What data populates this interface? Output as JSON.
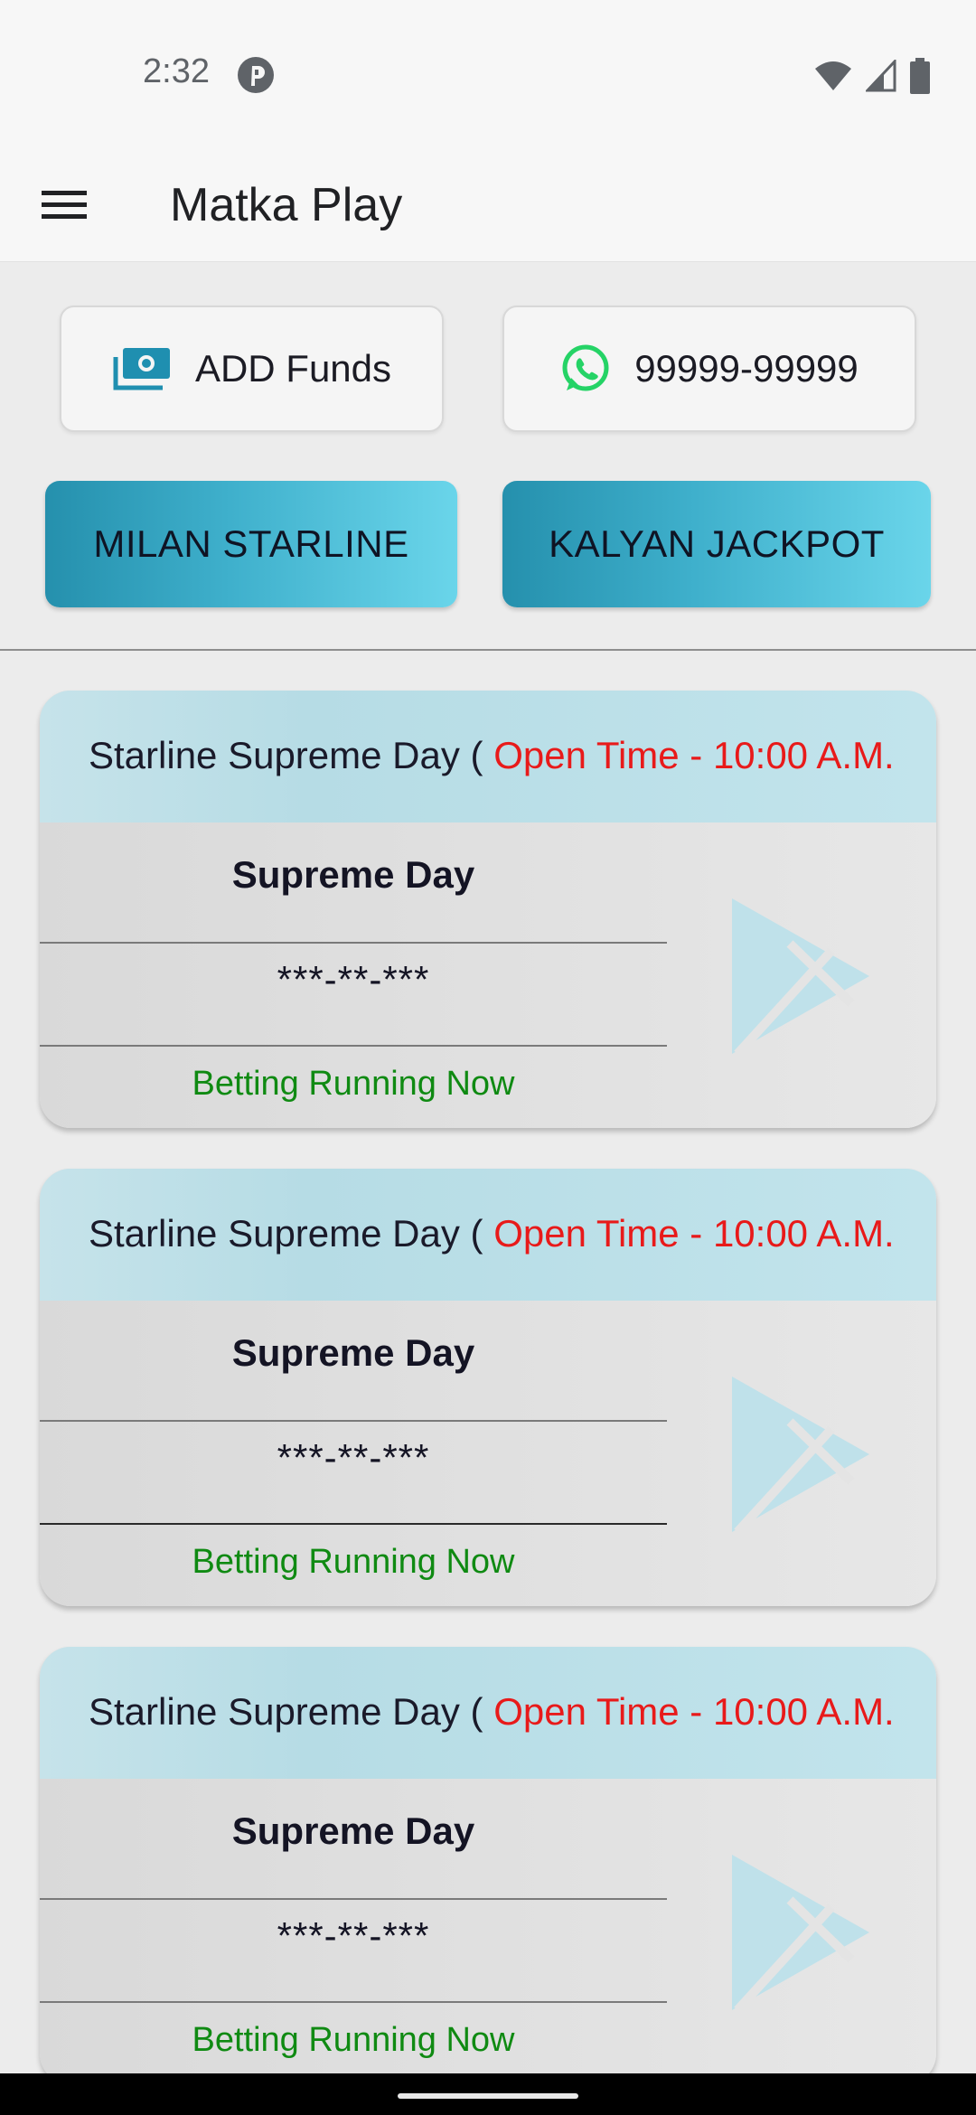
{
  "status_bar": {
    "time": "2:32",
    "app_icon": "pinterest-like-icon",
    "icons": [
      "wifi-icon",
      "signal-icon",
      "battery-icon"
    ]
  },
  "app_bar": {
    "title": "Matka Play",
    "menu_icon": "hamburger-menu-icon"
  },
  "actions": {
    "add_funds_label": "ADD Funds",
    "add_funds_icon": "money-icon",
    "phone_label": "99999-99999",
    "phone_icon": "whatsapp-icon"
  },
  "markets": {
    "milan_label": "MILAN STARLINE",
    "kalyan_label": "KALYAN JACKPOT"
  },
  "colors": {
    "accent_gradient_start": "#2590ad",
    "accent_gradient_end": "#6ad5ea",
    "open_time_red": "#e81a1a",
    "status_green": "#0f8a12",
    "whatsapp_green": "#25d366",
    "money_icon_teal": "#1f8fb0"
  },
  "cards": [
    {
      "title_prefix": "Starline Supreme Day (",
      "open_time": "Open Time - 10:00 A.M.",
      "name": "Supreme Day",
      "result": "***-**-***",
      "status": "Betting Running Now",
      "action_icon": "play-icon"
    },
    {
      "title_prefix": "Starline Supreme Day (",
      "open_time": "Open Time - 10:00 A.M.",
      "name": "Supreme Day",
      "result": "***-**-***",
      "status": "Betting Running Now",
      "action_icon": "play-icon"
    },
    {
      "title_prefix": "Starline Supreme Day (",
      "open_time": "Open Time - 10:00 A.M.",
      "name": "Supreme Day",
      "result": "***-**-***",
      "status": "Betting Running Now",
      "action_icon": "play-icon"
    }
  ]
}
